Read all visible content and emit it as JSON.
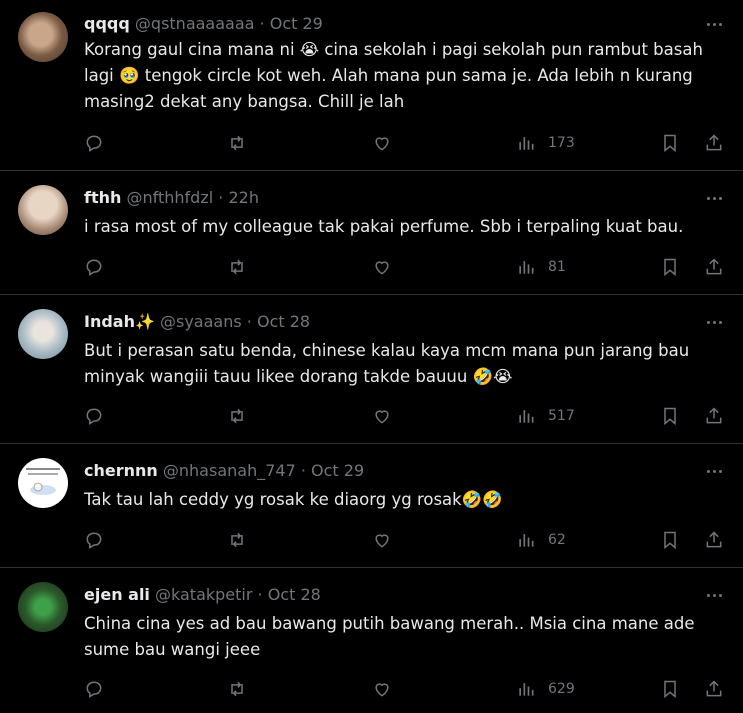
{
  "tweets": [
    {
      "name": "qqqq",
      "handle": "@qstnaaaaaaa",
      "sep": "·",
      "time": "Oct 29",
      "text": "Korang gaul cina mana ni 😭 cina sekolah i pagi sekolah pun rambut basah lagi 🥹 tengok circle kot weh. Alah mana pun sama je. Ada lebih n kurang masing2 dekat any bangsa. Chill je lah",
      "views": "173",
      "avatar_color": "#8a6d55"
    },
    {
      "name": "fthh",
      "handle": "@nfthhfdzl",
      "sep": "·",
      "time": "22h",
      "text": "i rasa most of my colleague tak pakai perfume. Sbb i terpaling kuat bau.",
      "views": "81",
      "avatar_color": "#c9b7a3"
    },
    {
      "name": "Indah✨",
      "handle": "@syaaans",
      "sep": "·",
      "time": "Oct 28",
      "text": "But i perasan satu benda,  chinese kalau kaya mcm mana pun jarang bau minyak wangiii tauu likee dorang takde bauuu 🤣😭",
      "views": "517",
      "avatar_color": "#b9c7cf"
    },
    {
      "name": "chernnn",
      "handle": "@nhasanah_747",
      "sep": "·",
      "time": "Oct 29",
      "text": "Tak tau lah ceddy yg rosak ke diaorg yg rosak🤣🤣",
      "views": "62",
      "avatar_color": "#ffffff"
    },
    {
      "name": "ejen ali",
      "handle": "@katakpetir",
      "sep": "·",
      "time": "Oct 28",
      "text": "China cina yes ad bau bawang putih bawang merah.. Msia cina mane ade sume bau wangi jeee",
      "views": "629",
      "avatar_color": "#2e4a2a"
    }
  ],
  "colors": {
    "background": "#000000",
    "text": "#e7e9ea",
    "muted": "#71767b",
    "divider": "#2f3336"
  }
}
